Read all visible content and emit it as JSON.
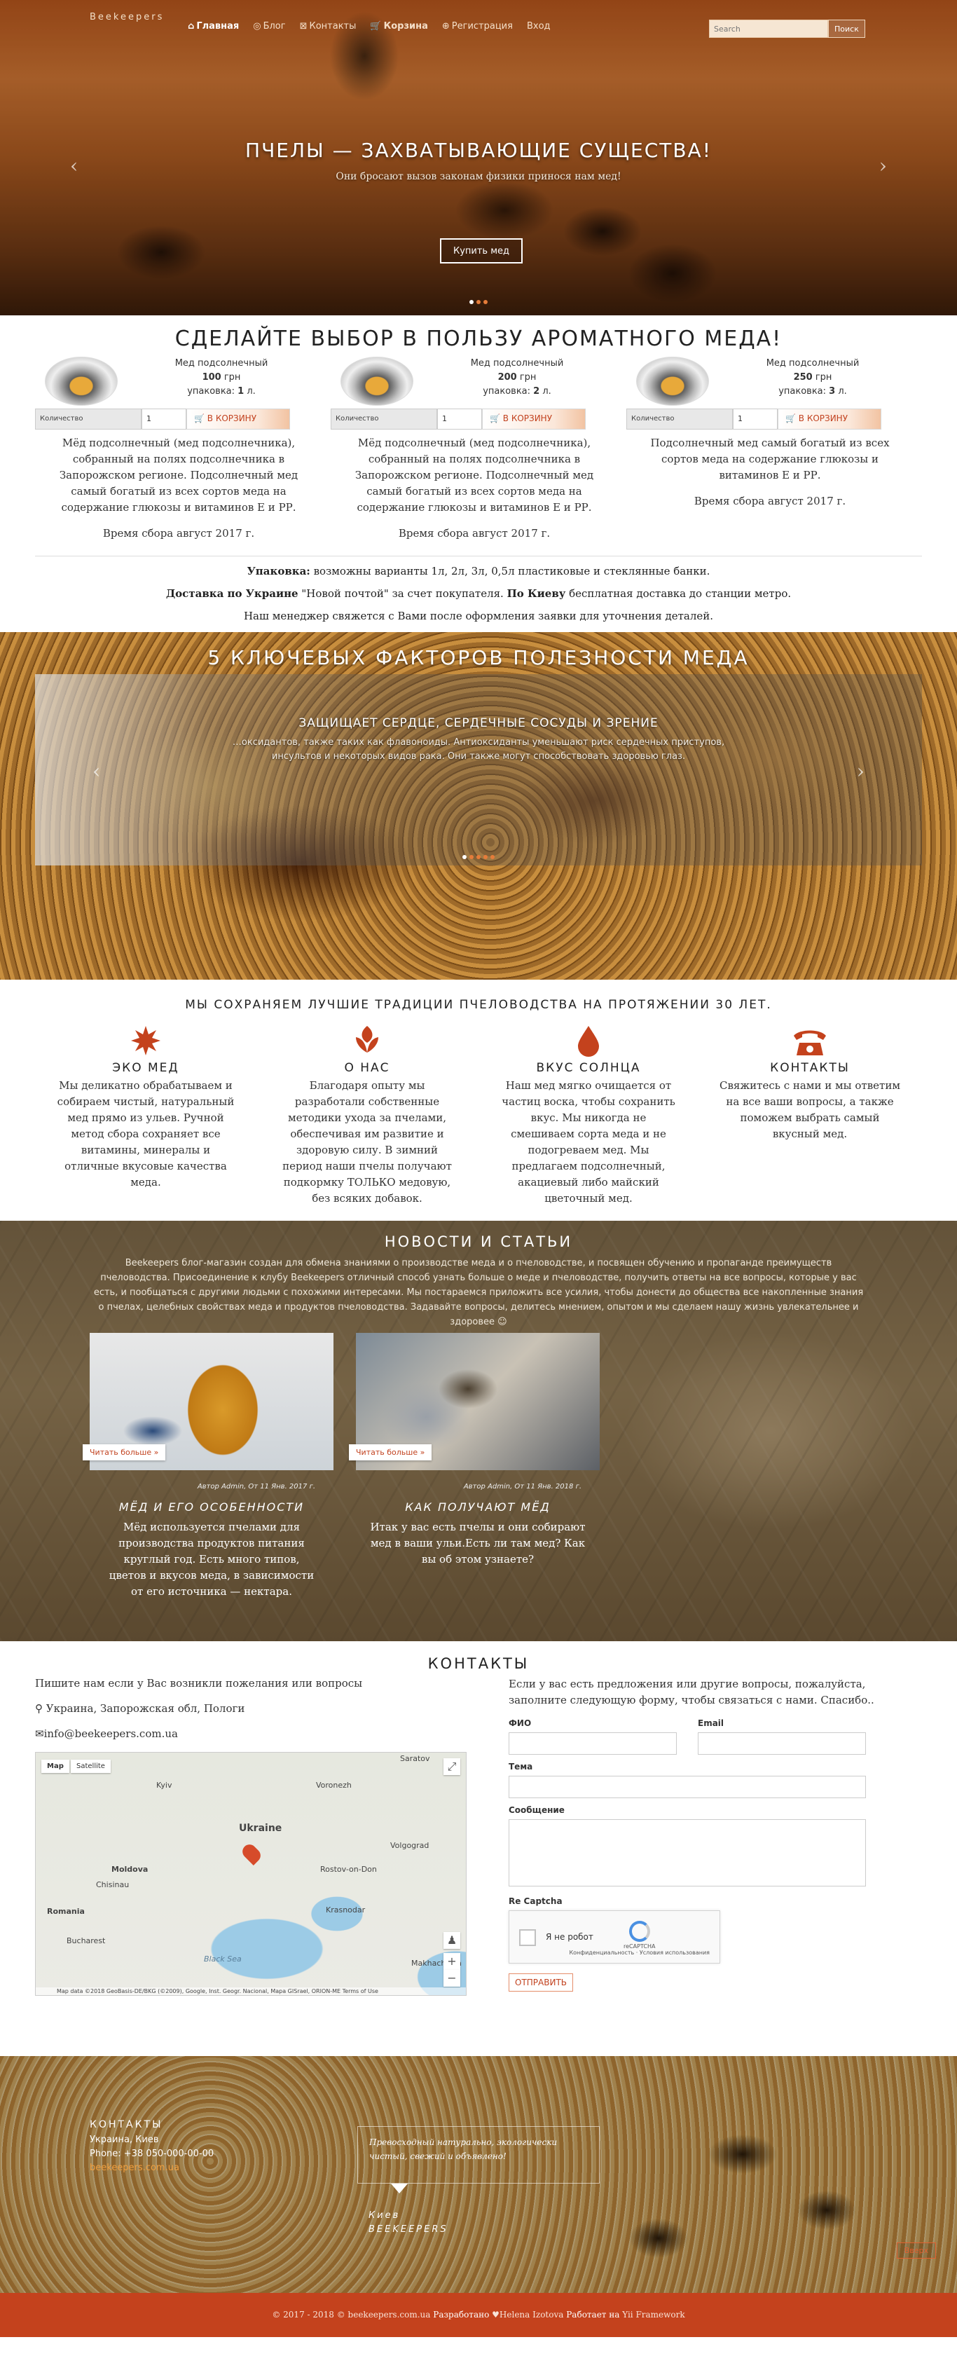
{
  "nav": {
    "brand": "Beekeepers",
    "items": [
      {
        "icon": "home-icon",
        "label": "Главная"
      },
      {
        "icon": "blog-icon",
        "label": "Блог"
      },
      {
        "icon": "contacts-icon",
        "label": "Контакты"
      },
      {
        "icon": "cart-icon",
        "label": "Корзина"
      },
      {
        "icon": "register-icon",
        "label": "Регистрация"
      },
      {
        "icon": "",
        "label": "Вход"
      }
    ],
    "search_placeholder": "Search",
    "search_button": "Поиск"
  },
  "hero": {
    "title": "ПЧЕЛЫ — ЗАХВАТЫВАЮЩИЕ СУЩЕСТВА!",
    "subtitle": "Они бросают вызов законам физики принося нам мед!",
    "cta": "Купить мед"
  },
  "products": {
    "title": "СДЕЛАЙТЕ ВЫБОР В ПОЛЬЗУ АРОМАТНОГО МЕДА!",
    "qty_label": "Количество",
    "cart_label": "В КОРЗИНУ",
    "items": [
      {
        "name": "Мед подсолнечный",
        "price": "100",
        "currency": "грн",
        "pack_label": "упаковка:",
        "pack": "1",
        "unit": "л.",
        "qty": "1",
        "desc": "Мёд подсолнечный (мед подсолнечника), собранный на полях подсолнечника в Запорожском регионе. Подсолнечный мед самый богатый из всех сортов меда на содержание глюкозы и витаминов Е и РР.",
        "harvest": "Время сбора август 2017 г."
      },
      {
        "name": "Мед подсолнечный",
        "price": "200",
        "currency": "грн",
        "pack_label": "упаковка:",
        "pack": "2",
        "unit": "л.",
        "qty": "1",
        "desc": "Мёд подсолнечный (мед подсолнечника), собранный на полях подсолнечника в Запорожском регионе. Подсолнечный мед самый богатый из всех сортов меда на содержание глюкозы и витаминов Е и РР.",
        "harvest": "Время сбора август 2017 г."
      },
      {
        "name": "Мед подсолнечный",
        "price": "250",
        "currency": "грн",
        "pack_label": "упаковка:",
        "pack": "3",
        "unit": "л.",
        "qty": "1",
        "desc": "Подсолнечный мед самый богатый из всех сортов меда на содержание глюкозы и витаминов Е и РР.",
        "harvest": "Время сбора август 2017 г."
      }
    ],
    "packaging_label": "Упаковка:",
    "packaging_text": " возможны варианты 1л, 2л, 3л, 0,5л пластиковые и стеклянные банки.",
    "delivery_label": "Доставка по Украине",
    "delivery_text1": " \"Новой почтой\" за счет покупателя. ",
    "delivery_label2": "По Киеву",
    "delivery_text2": " бесплатная доставка до станции метро.",
    "manager_text": "Наш менеджер свяжется с Вами после оформления заявки для уточнения деталей."
  },
  "factors": {
    "title": "5 КЛЮЧЕВЫХ ФАКТОРОВ ПОЛЕЗНОСТИ МЕДА",
    "slide_heading": "ЗАЩИЩАЕТ СЕРДЦЕ, СЕРДЕЧНЫЕ СОСУДЫ И ЗРЕНИЕ",
    "slide_text": "…оксидантов, также таких как флавоноиды. Антиоксиданты уменьшают риск сердечных приступов, инсультов и некоторых видов рака. Они также могут способствовать здоровью глаз."
  },
  "traditions": {
    "title": "МЫ СОХРАНЯЕМ ЛУЧШИЕ ТРАДИЦИИ ПЧЕЛОВОДСТВА НА ПРОТЯЖЕНИИ 30 ЛЕТ.",
    "items": [
      {
        "icon": "sun-icon",
        "title": "ЭКО МЕД",
        "text": "Мы деликатно обрабатываем и собираем чистый, натуральный мед прямо из ульев. Ручной метод сбора сохраняет все витамины, минералы и отличные вкусовые качества меда."
      },
      {
        "icon": "leaf-icon",
        "title": "О НАС",
        "text": "Благодаря опыту мы разработали собственные методики ухода за пчелами, обеспечивая им развитие и здоровую силу. В зимний период наши пчелы получают подкормку ТОЛЬКО медовую, без всяких добавок."
      },
      {
        "icon": "drop-icon",
        "title": "ВКУС СОЛНЦА",
        "text": "Наш мед мягко очищается от частиц воска, чтобы сохранить вкус. Мы никогда не смешиваем сорта меда и не подогреваем мед. Мы предлагаем подсолнечный, акациевый либо майский цветочный мед."
      },
      {
        "icon": "phone-icon",
        "title": "КОНТАКТЫ",
        "text": "Свяжитесь с нами и мы ответим на все ваши вопросы, а также поможем выбрать самый вкусный мед."
      }
    ]
  },
  "news": {
    "title": "НОВОСТИ И СТАТЬИ",
    "intro": "Beekeepers блог-магазин создан для обмена знаниями о производстве меда и о пчеловодстве, и посвящен обучению и пропаганде преимуществ пчеловодства. Присоединение к клубу Beekeepers отличный способ узнать больше о меде и пчеловодстве, получить ответы на все вопросы, которые у вас есть, и пообщаться с другими людьми с похожими интересами. Мы постараемся приложить все усилия, чтобы донести до общества все накопленные знания о пчелах, целебных свойствах меда и продуктов пчеловодства. Задавайте вопросы, делитесь мнением, опытом и мы сделаем нашу жизнь увлекательнее и здоровее ☺",
    "more_label": "Читать больше »",
    "articles": [
      {
        "meta": "Автор Admin, Oт 11 Янв. 2017 г.",
        "title": "МЁД И ЕГО ОСОБЕННОСТИ",
        "text": "Мёд используется пчелами для производства продуктов питания круглый год. Есть много типов, цветов и вкусов меда, в зависимости от его источника — нектара."
      },
      {
        "meta": "Автор Admin, Oт 11 Янв. 2018 г.",
        "title": "КАК ПОЛУЧАЮТ МЁД",
        "text": "Итак у вас есть пчелы и они собирают мед в ваши ульи.Есть ли там мед? Как вы об этом узнаете?"
      }
    ]
  },
  "contacts": {
    "title": "КОНТАКТЫ",
    "write_text": "Пишите нам если у Вас возникли пожелания или вопросы",
    "address": "Украина, Запорожская обл, Пологи",
    "email": "info@beekeepers.com.ua",
    "map": {
      "tab_map": "Map",
      "tab_sat": "Satellite",
      "labels": [
        "Ukraine",
        "Kyiv",
        "Moldova",
        "Romania",
        "Bucharest",
        "Chisinau",
        "Voronezh",
        "Saratov",
        "Volgograd",
        "Rostov-on-Don",
        "Krasnodar",
        "Black Sea",
        "Makhachkala"
      ],
      "footer": "Map data ©2018 GeoBasis-DE/BKG (©2009), Google, Inst. Geogr. Nacional, Mapa GISrael, ORION-ME   Terms of Use"
    },
    "form_intro": "Если у вас есть предложения или другие вопросы, пожалуйста, заполните следующую форму, чтобы связаться с нами. Спасибо..",
    "fio_label": "ФИО",
    "email_label": "Email",
    "subject_label": "Тема",
    "message_label": "Сообщение",
    "captcha_label": "Re Captcha",
    "captcha_text": "Я не робот",
    "captcha_brand": "reCAPTCHA",
    "captcha_links": "Конфиденциальность · Условия использования",
    "send_label": "ОТПРАВИТЬ"
  },
  "bottom": {
    "heading": "КОНТАКТЫ",
    "country": "Украина, Киев",
    "phone": "Phone: +38 050-000-00-00",
    "site": "beekeepers.com.ua",
    "quote": "Превосходный натурально, экологически чистый, свежий и объявлено!",
    "city": "Киев",
    "company": "BEEKEEPERS",
    "top_label": "Вверх"
  },
  "footer": {
    "copy": "© 2017 - 2018 © beekeepers.com.ua",
    "dev_label": "Разработано",
    "author": "Helena Izotova",
    "powered_label": "Работает на",
    "framework": "Yii Framework"
  }
}
